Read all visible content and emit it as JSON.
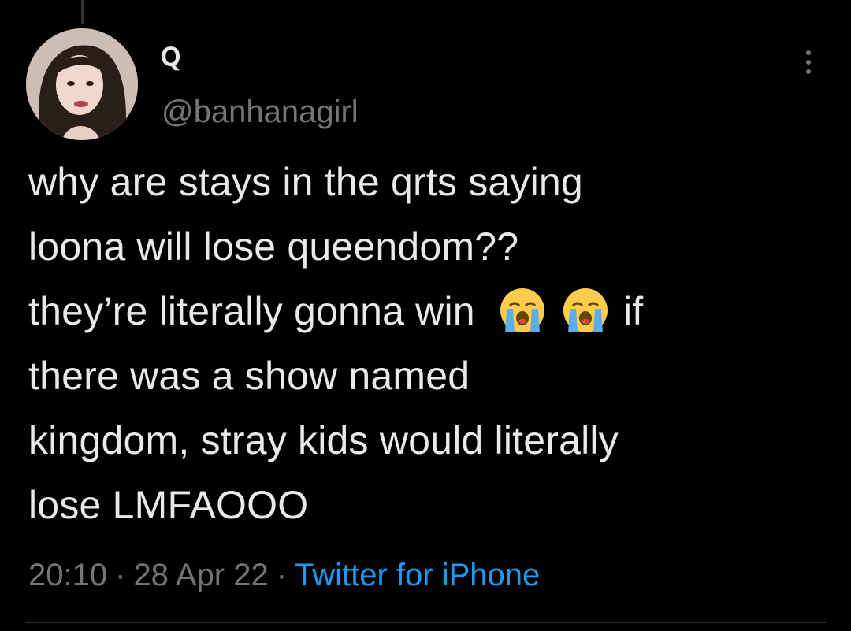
{
  "tweet": {
    "display_name": "ꞯ",
    "handle": "@banhanagirl",
    "text_lines": [
      "why are stays in the qrts saying",
      "loona will lose queendom??",
      "they’re literally gonna win",
      "there was a show named",
      "kingdom, stray kids would literally",
      "lose LMFAOOO"
    ],
    "line3_after_emoji": "if",
    "emojis": [
      "loudly-crying-face-icon",
      "loudly-crying-face-icon"
    ],
    "time": "20:10",
    "date": "28 Apr 22",
    "separator": "·",
    "source": "Twitter for iPhone"
  },
  "colors": {
    "background": "#000000",
    "text": "#e7e9ea",
    "muted": "#71767b",
    "link": "#1d9bf0",
    "emoji_face": "#ffcc4d",
    "emoji_tears": "#5dadec"
  }
}
